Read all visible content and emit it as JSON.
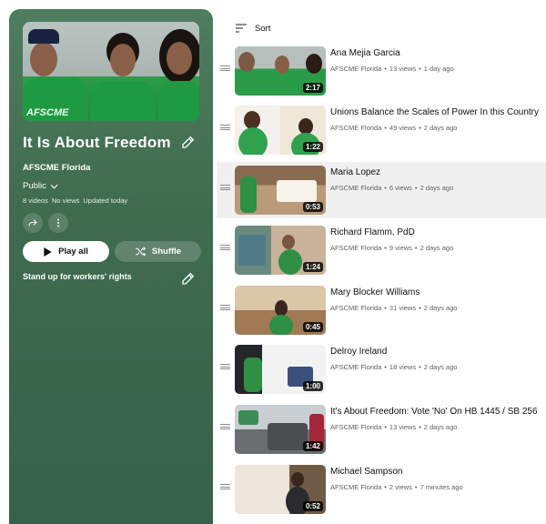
{
  "playlist": {
    "title": "It Is About Freedom",
    "owner": "AFSCME Florida",
    "privacy": "Public",
    "video_count": "8 videos",
    "views": "No views",
    "updated": "Updated today",
    "play_all_label": "Play all",
    "shuffle_label": "Shuffle",
    "description": "Stand up for workers' rights",
    "hero_shirt_text": "AFSCME"
  },
  "sort_label": "Sort",
  "videos": [
    {
      "title": "Ana Mejia Garcia",
      "channel": "AFSCME Florida",
      "views": "13 views",
      "age": "1 day ago",
      "duration": "2:17"
    },
    {
      "title": "Unions Balance the Scales of Power In this Country",
      "channel": "AFSCME Florida",
      "views": "49 views",
      "age": "2 days ago",
      "duration": "1:22"
    },
    {
      "title": "Maria Lopez",
      "channel": "AFSCME Florida",
      "views": "6 views",
      "age": "2 days ago",
      "duration": "0:53"
    },
    {
      "title": "Richard Flamm, PdD",
      "channel": "AFSCME Florida",
      "views": "9 views",
      "age": "2 days ago",
      "duration": "1:24"
    },
    {
      "title": "Mary Blocker Williams",
      "channel": "AFSCME Florida",
      "views": "31 views",
      "age": "2 days ago",
      "duration": "0:45"
    },
    {
      "title": "Delroy Ireland",
      "channel": "AFSCME Florida",
      "views": "18 views",
      "age": "2 days ago",
      "duration": "1:00"
    },
    {
      "title": "It's About Freedom: Vote 'No' On HB 1445 / SB 256",
      "channel": "AFSCME Florida",
      "views": "13 views",
      "age": "2 days ago",
      "duration": "1:42"
    },
    {
      "title": "Michael Sampson",
      "channel": "AFSCME Florida",
      "views": "2 views",
      "age": "7 minutes ago",
      "duration": "0:52"
    }
  ],
  "meta_separator": "•",
  "colors": {
    "panel": "#3f6b4f",
    "accent_green": "#1e9a42",
    "active_row": "#f0f0f0"
  }
}
